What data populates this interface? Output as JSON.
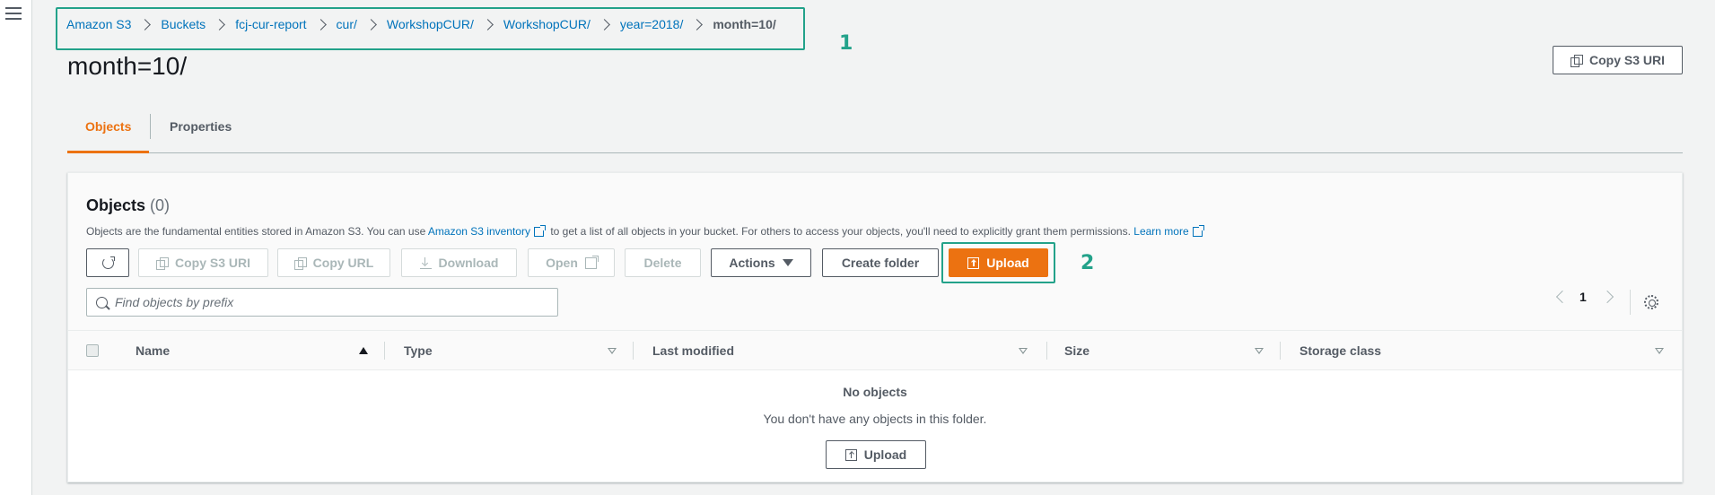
{
  "breadcrumbs": [
    {
      "label": "Amazon S3"
    },
    {
      "label": "Buckets"
    },
    {
      "label": "fcj-cur-report"
    },
    {
      "label": "cur/"
    },
    {
      "label": "WorkshopCUR/"
    },
    {
      "label": "WorkshopCUR/"
    },
    {
      "label": "year=2018/"
    },
    {
      "label": "month=10/"
    }
  ],
  "annotations": {
    "marker_1": "1",
    "marker_2": "2",
    "color": "#23a28a"
  },
  "page": {
    "title": "month=10/",
    "copy_s3_uri_label": "Copy S3 URI"
  },
  "tabs": [
    {
      "label": "Objects",
      "active": true
    },
    {
      "label": "Properties",
      "active": false
    }
  ],
  "objects_panel": {
    "title": "Objects",
    "count": "(0)",
    "description": {
      "pre": "Objects are the fundamental entities stored in Amazon S3. You can use",
      "inventory_link": "Amazon S3 inventory",
      "mid": "to get a list of all objects in your bucket. For others to access your objects, you'll need to explicitly grant them permissions.",
      "learn_more": "Learn more"
    },
    "toolbar": {
      "refresh_icon": "refresh-icon",
      "copy_s3_uri": "Copy S3 URI",
      "copy_url": "Copy URL",
      "download": "Download",
      "open": "Open",
      "delete": "Delete",
      "actions": "Actions",
      "create_folder": "Create folder",
      "upload": "Upload"
    },
    "search": {
      "placeholder": "Find objects by prefix",
      "value": ""
    },
    "pagination": {
      "current_page": "1"
    },
    "columns": [
      "Name",
      "Type",
      "Last modified",
      "Size",
      "Storage class"
    ],
    "rows": [],
    "empty_state": {
      "title": "No objects",
      "description": "You don't have any objects in this folder.",
      "upload_label": "Upload"
    }
  },
  "colors": {
    "accent": "#ec7211",
    "link": "#0073bb",
    "highlight": "#23a28a"
  }
}
